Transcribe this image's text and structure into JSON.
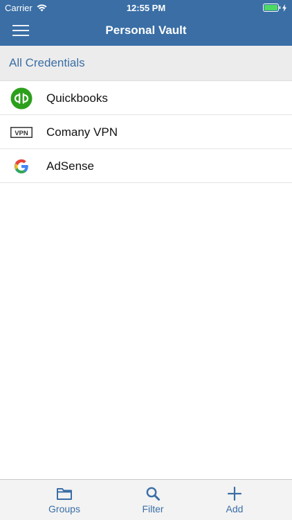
{
  "status_bar": {
    "carrier": "Carrier",
    "time": "12:55 PM"
  },
  "navbar": {
    "title": "Personal Vault",
    "menu_icon": "hamburger-icon"
  },
  "section": {
    "title": "All Credentials"
  },
  "credentials": [
    {
      "label": "Quickbooks",
      "icon": "quickbooks-logo-icon"
    },
    {
      "label": "Comany VPN",
      "icon": "vpn-icon"
    },
    {
      "label": "AdSense",
      "icon": "google-logo-icon"
    }
  ],
  "tabs": [
    {
      "label": "Groups",
      "icon": "folder-icon"
    },
    {
      "label": "Filter",
      "icon": "search-icon"
    },
    {
      "label": "Add",
      "icon": "plus-icon"
    }
  ],
  "colors": {
    "primary": "#3a6ea5",
    "header_bg": "#ececec",
    "tabbar_bg": "#f3f3f3",
    "quickbooks_green": "#2ca01c",
    "battery_green": "#4cd964"
  }
}
